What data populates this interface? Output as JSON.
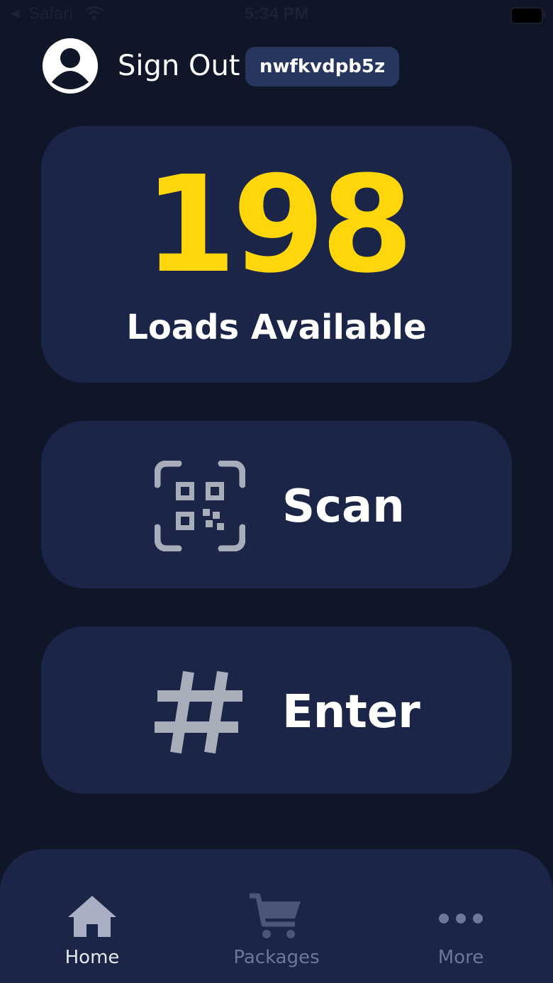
{
  "status_bar": {
    "back_glyph": "◀",
    "app_name": "Safari",
    "time": "5:34 PM"
  },
  "header": {
    "avatar_icon": "user-avatar-icon",
    "sign_out_label": "Sign Out",
    "user_code": "nwfkvdpb5z"
  },
  "loads": {
    "count": "198",
    "label": "Loads Available",
    "number_color": "#ffd60a"
  },
  "actions": [
    {
      "icon": "qr-code-icon",
      "label": "Scan"
    },
    {
      "icon": "hash-icon",
      "label": "Enter"
    }
  ],
  "tab_bar": {
    "tabs": [
      {
        "icon": "home-icon",
        "label": "Home",
        "active": true
      },
      {
        "icon": "cart-icon",
        "label": "Packages",
        "active": false
      },
      {
        "icon": "more-icon",
        "label": "More",
        "active": false
      }
    ]
  },
  "colors": {
    "background": "#0e1628",
    "card": "#1a2548",
    "badge": "#27365f",
    "accent": "#ffd60a",
    "inactive_tab": "#6c779a"
  }
}
